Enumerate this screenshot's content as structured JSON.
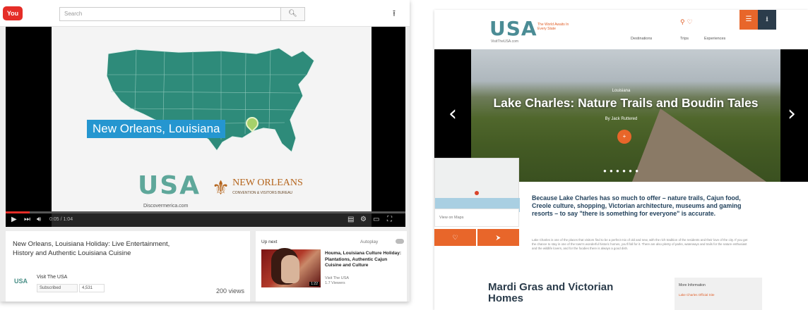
{
  "youtube": {
    "logo_text": "You",
    "search_placeholder": "Search",
    "search_icon": "search-icon",
    "video": {
      "map_label": "New Orleans, Louisiana",
      "usa_logo": "USA",
      "usa_site": "Discovermerica.com",
      "no_logo_name": "NEW ORLEANS",
      "no_logo_sub": "CONVENTION & VISITORS BUREAU",
      "time": "0:05 / 1:04",
      "progress_fraction": 0.06,
      "map_color": "#2e8b7a"
    },
    "title": "New Orleans, Louisiana Holiday: Live Entertainment, History and Authentic Louisiana Cuisine",
    "channel": {
      "logo": "USA",
      "name": "Visit The USA",
      "subscribe": "Subscribed",
      "subscriber_count": "4,531"
    },
    "views": "200 views",
    "up_next": {
      "heading": "Up next",
      "autoplay": "Autoplay",
      "title": "Houma, Louisiana Culture Holiday: Plantations, Authentic Cajun Cuisine and Culture",
      "channel": "Visit The USA",
      "views": "1.7 Viewers",
      "duration": "1:22"
    }
  },
  "site": {
    "logo": "USA",
    "logo_sub": "VisitTheUSA.com",
    "tagline": "The World Awaits In Every State",
    "nav": [
      "Destinations",
      "Trips",
      "Experiences"
    ],
    "menu_icon": "hamburger-icon",
    "download_icon": "download-icon",
    "hero": {
      "kicker": "Louisiana",
      "title": "Lake Charles: Nature Trails and Boudin Tales",
      "author": "By Jack Ruttered",
      "dots": "● ● ● ● ● ●"
    },
    "map_bar_text": "View on Maps",
    "lead": "Because Lake Charles has so much to offer – nature trails, Cajun food, Creole culture, shopping, Victorian architecture, museums and gaming resorts – to say \"there is something for everyone\" is accurate.",
    "body": "Lake Charles is one of the places that visitors find to be a perfect mix of old and new, with the rich tradition of the residents and their love of the city. If you get the chance to stay in one of the town's wonderful historic homes, you'll fall for it. There are also plenty of parks, waterways and trails for the nature enthusiast and the wildlife lovers, and for the foodies there is always a good dish.",
    "section_heading": "Mardi Gras and Victorian Homes",
    "aside_title": "More Information",
    "aside_link": "Lake Charles Official Site"
  }
}
